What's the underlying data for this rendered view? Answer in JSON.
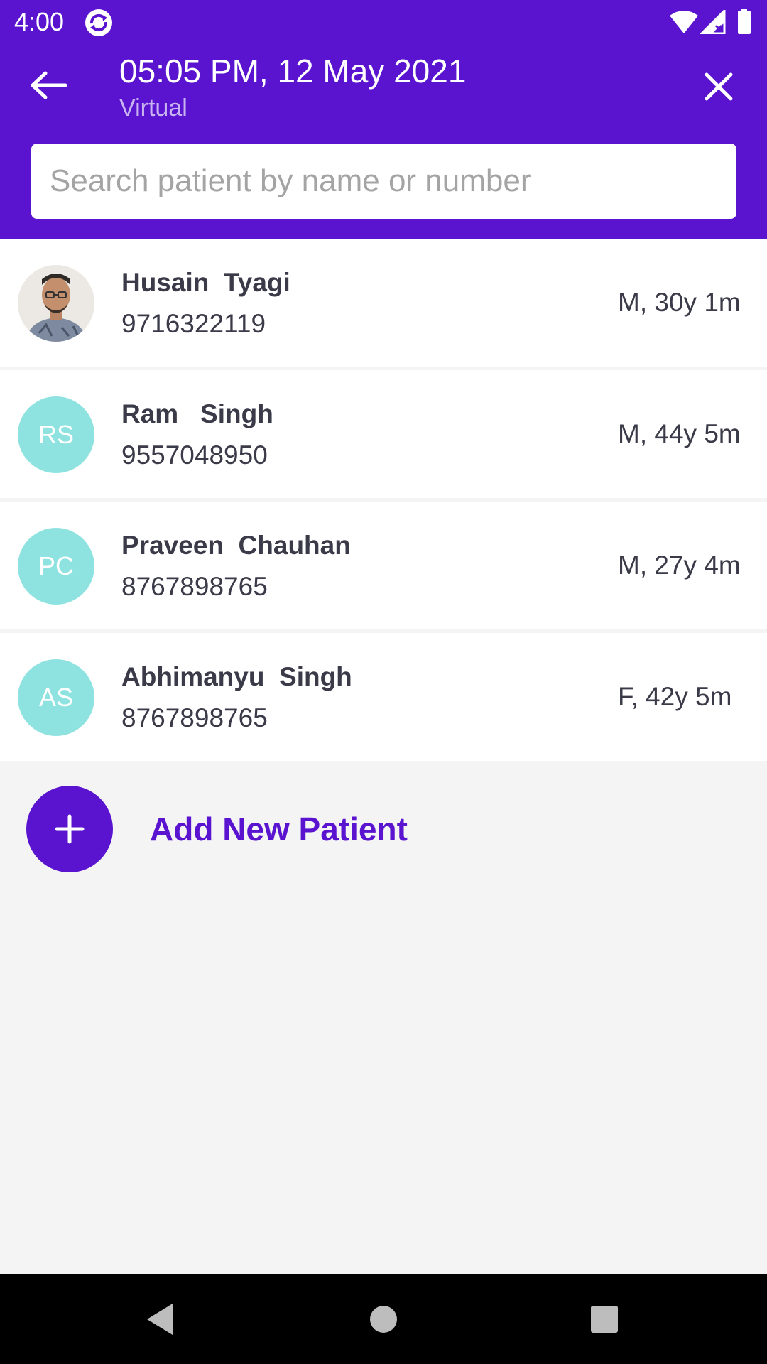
{
  "status_bar": {
    "time": "4:00",
    "app_icon": "sync-app-icon",
    "wifi_icon": "wifi-icon",
    "signal_icon": "signal-icon",
    "battery_icon": "battery-icon"
  },
  "header": {
    "back_icon": "arrow-back-icon",
    "title": "05:05 PM, 12 May 2021",
    "subtitle": "Virtual",
    "close_icon": "close-icon",
    "background_color": "#5a14d0"
  },
  "search": {
    "value": "",
    "placeholder": "Search patient by name or number"
  },
  "patients": [
    {
      "initials": "",
      "photo": true,
      "name": "Husain  Tyagi",
      "phone": "9716322119",
      "meta": "M, 30y 1m"
    },
    {
      "initials": "RS",
      "photo": false,
      "name": "Ram   Singh",
      "phone": "9557048950",
      "meta": "M, 44y 5m"
    },
    {
      "initials": "PC",
      "photo": false,
      "name": "Praveen  Chauhan",
      "phone": "8767898765",
      "meta": "M, 27y 4m"
    },
    {
      "initials": "AS",
      "photo": false,
      "name": "Abhimanyu  Singh",
      "phone": "8767898765",
      "meta": "F, 42y 5m"
    }
  ],
  "add_patient": {
    "icon": "plus-icon",
    "label": "Add New Patient"
  },
  "nav_bar": {
    "back_icon": "nav-back-icon",
    "home_icon": "nav-home-icon",
    "recents_icon": "nav-recents-icon"
  },
  "colors": {
    "accent": "#5a14d0",
    "avatar": "#8ee3e0",
    "text": "#3a3a48",
    "background": "#f4f4f4"
  }
}
